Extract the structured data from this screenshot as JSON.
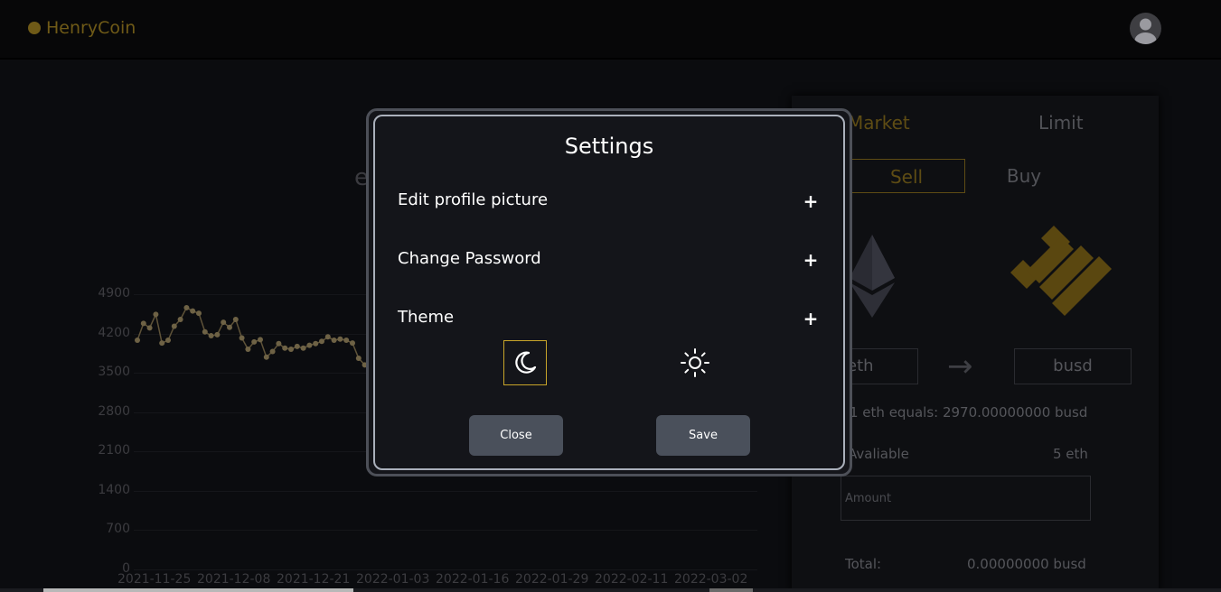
{
  "header": {
    "logo_text": "HenryCoin",
    "avatar_icon": "user-avatar-icon"
  },
  "chart": {
    "title_fragment": "e",
    "y_ticks": [
      "4900",
      "4200",
      "3500",
      "2800",
      "2100",
      "1400",
      "700",
      "0"
    ],
    "x_ticks": [
      "2021-11-25",
      "2021-12-08",
      "2021-12-21",
      "2022-01-03",
      "2022-01-16",
      "2022-01-29",
      "2022-02-11",
      "2022-03-02"
    ]
  },
  "chart_data": {
    "type": "line",
    "ylim": [
      0,
      4900
    ],
    "xlabel": "",
    "ylabel": "",
    "x_start": "2021-11-25",
    "series": [
      {
        "values": [
          4080,
          4380,
          4300,
          4540,
          4030,
          4080,
          4330,
          4450,
          4660,
          4600,
          4560,
          4230,
          4160,
          4180,
          4400,
          4310,
          4450,
          4120,
          3920,
          4050,
          4090,
          3780,
          3880,
          4020,
          3940,
          3920,
          3970,
          3940,
          3990,
          4020,
          4060,
          4140,
          4080,
          4100,
          4080,
          4030,
          3760,
          3640
        ]
      }
    ]
  },
  "trade": {
    "tab_market": "Market",
    "tab_limit": "Limit",
    "sell": "Sell",
    "buy": "Buy",
    "from_token": "eth",
    "to_token": "busd",
    "rate": "1 eth equals: 2970.00000000 busd",
    "available_label": "Avaliable",
    "available_value": "5 eth",
    "amount_placeholder": "Amount",
    "total_label": "Total:",
    "total_value": "0.00000000 busd"
  },
  "modal": {
    "title": "Settings",
    "edit_profile": "Edit profile picture",
    "change_password": "Change Password",
    "theme": "Theme",
    "plus": "+",
    "close": "Close",
    "save": "Save",
    "selected_theme": "dark"
  },
  "colors": {
    "accent": "#c8a52a",
    "modal_bg": "#14151a",
    "button_bg": "#4a505b"
  }
}
